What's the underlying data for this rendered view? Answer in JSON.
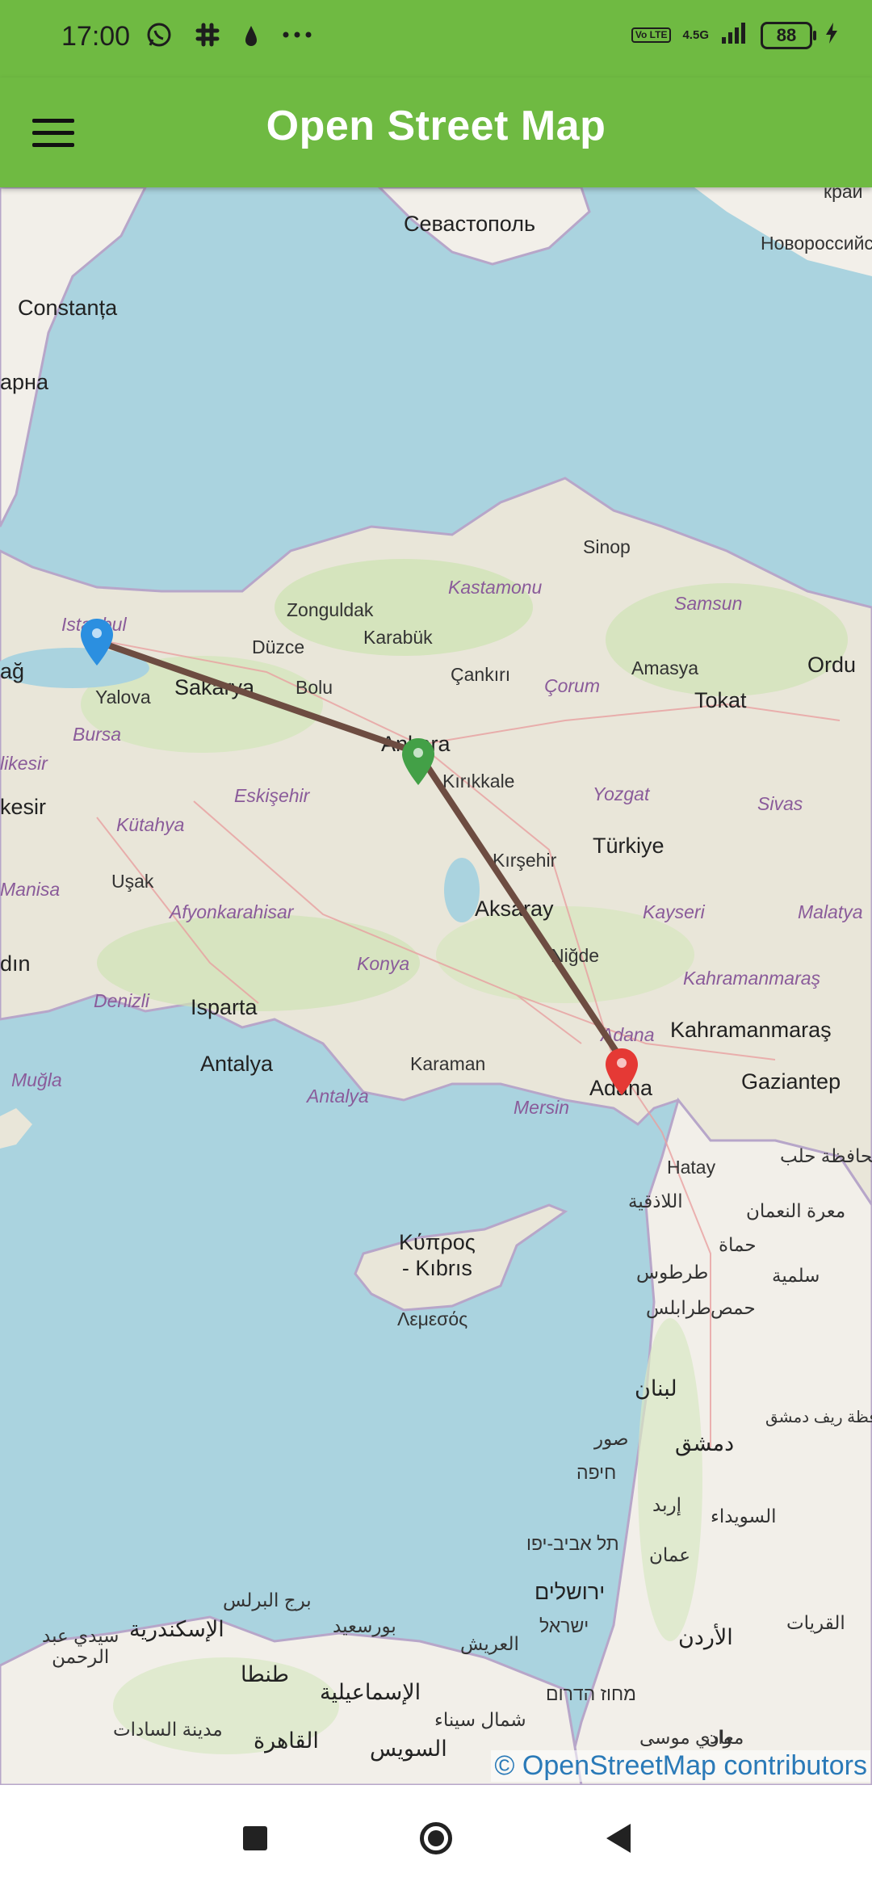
{
  "status_bar": {
    "time": "17:00",
    "left_icons": [
      "whatsapp-icon",
      "slack-icon",
      "drop-icon",
      "more-dots-icon"
    ],
    "network": "4.5G",
    "volte": "Vo LTE",
    "battery": "88"
  },
  "app_bar": {
    "title": "Open Street Map",
    "menu_icon": "hamburger-menu-icon",
    "background": "#6fba42"
  },
  "map": {
    "route_color": "#6d4c41",
    "markers": [
      {
        "name": "blue-marker",
        "color": "#2b8fe0",
        "city": "Istanbul"
      },
      {
        "name": "green-marker",
        "color": "#43a047",
        "city": "Ankara"
      },
      {
        "name": "red-marker",
        "color": "#e53935",
        "city": "Adana"
      }
    ],
    "labels": {
      "sevastopol": "Севастополь",
      "novorossiysk": "Новороссийс",
      "krai": "край",
      "constanta": "Constanța",
      "varna": "арна",
      "sinop": "Sinop",
      "zonguldak": "Zonguldak",
      "kastamonu": "Kastamonu",
      "samsun": "Samsun",
      "karabuk": "Karabük",
      "duzce": "Düzce",
      "cankiri": "Çankırı",
      "amasya": "Amasya",
      "ordu": "Ordu",
      "istanbul": "Istanbul",
      "sakarya": "Sakarya",
      "bolu": "Bolu",
      "corum": "Çorum",
      "tokat": "Tokat",
      "tekirdag": "ağ",
      "yalova": "Yalova",
      "bursa": "Bursa",
      "ankara": "Ankara",
      "kirikkale": "Kırıkkale",
      "yozgat": "Yozgat",
      "sivas": "Sivas",
      "balikesir_a": "likesir",
      "balikesir_b": "kesir",
      "eskisehir": "Eskişehir",
      "kutahya": "Kütahya",
      "kirsehir": "Kırşehir",
      "turkiye": "Türkiye",
      "usak": "Uşak",
      "manisa": "Manisa",
      "afyon": "Afyonkarahisar",
      "aksaray": "Aksaray",
      "kayseri": "Kayseri",
      "malatya": "Malatya",
      "konya": "Konya",
      "nigde": "Niğde",
      "aydin": "dın",
      "denizli": "Denizli",
      "isparta": "Isparta",
      "kahramanmaras_r": "Kahramanmaraş",
      "kahramanmaras": "Kahramanmaraş",
      "adana_r": "Adana",
      "adana": "Adana",
      "antalya": "Antalya",
      "antalya_r": "Antalya",
      "karaman": "Karaman",
      "mersin": "Mersin",
      "gaziantep": "Gaziantep",
      "mugla": "Muğla",
      "hatay": "Hatay",
      "latakia": "اللاذقية",
      "kibris": "Κύπρος\n- Kıbrıs",
      "lemesos": "Λεμεσός",
      "aleppo": "محافظة حلب",
      "idlib": "معرة النعمان",
      "hama": "حماة",
      "tartus": "طرطوس",
      "salamiyah": "سلمية",
      "tripoli": "طرابلس",
      "homs": "حمص",
      "lebanon": "لبنان",
      "damascus_r": "محافظة ريف دمشق",
      "sur": "صور",
      "damascus": "دمشق",
      "haifa": "חיפה",
      "irbid": "إربد",
      "sweida": "السويداء",
      "telaviv": "תל אביב-יפו",
      "amman": "عمان",
      "jerusalem": "ירושלים",
      "israel": "ישראל",
      "jordan": "الأردن",
      "qurayyat": "القريات",
      "burj": "برج البرلس",
      "alexandria": "الإسكندرية",
      "sidi": "سيدي عبد\nالرحمن",
      "portsaid": "بورسعيد",
      "arish": "العريش",
      "tanta": "طنطا",
      "ismailia": "الإسماعيلية",
      "sinai": "شمال سيناء",
      "south": "מחוז הדרום",
      "sadat": "مدينة السادات",
      "cairo": "القاهرة",
      "suez": "السويس",
      "wadi": "وادي موسى",
      "maan": "معان"
    },
    "attribution": "© OpenStreetMap contributors"
  },
  "nav_bar": {
    "recent_icon": "square-icon",
    "home_icon": "circle-home-icon",
    "back_icon": "triangle-back-icon"
  }
}
